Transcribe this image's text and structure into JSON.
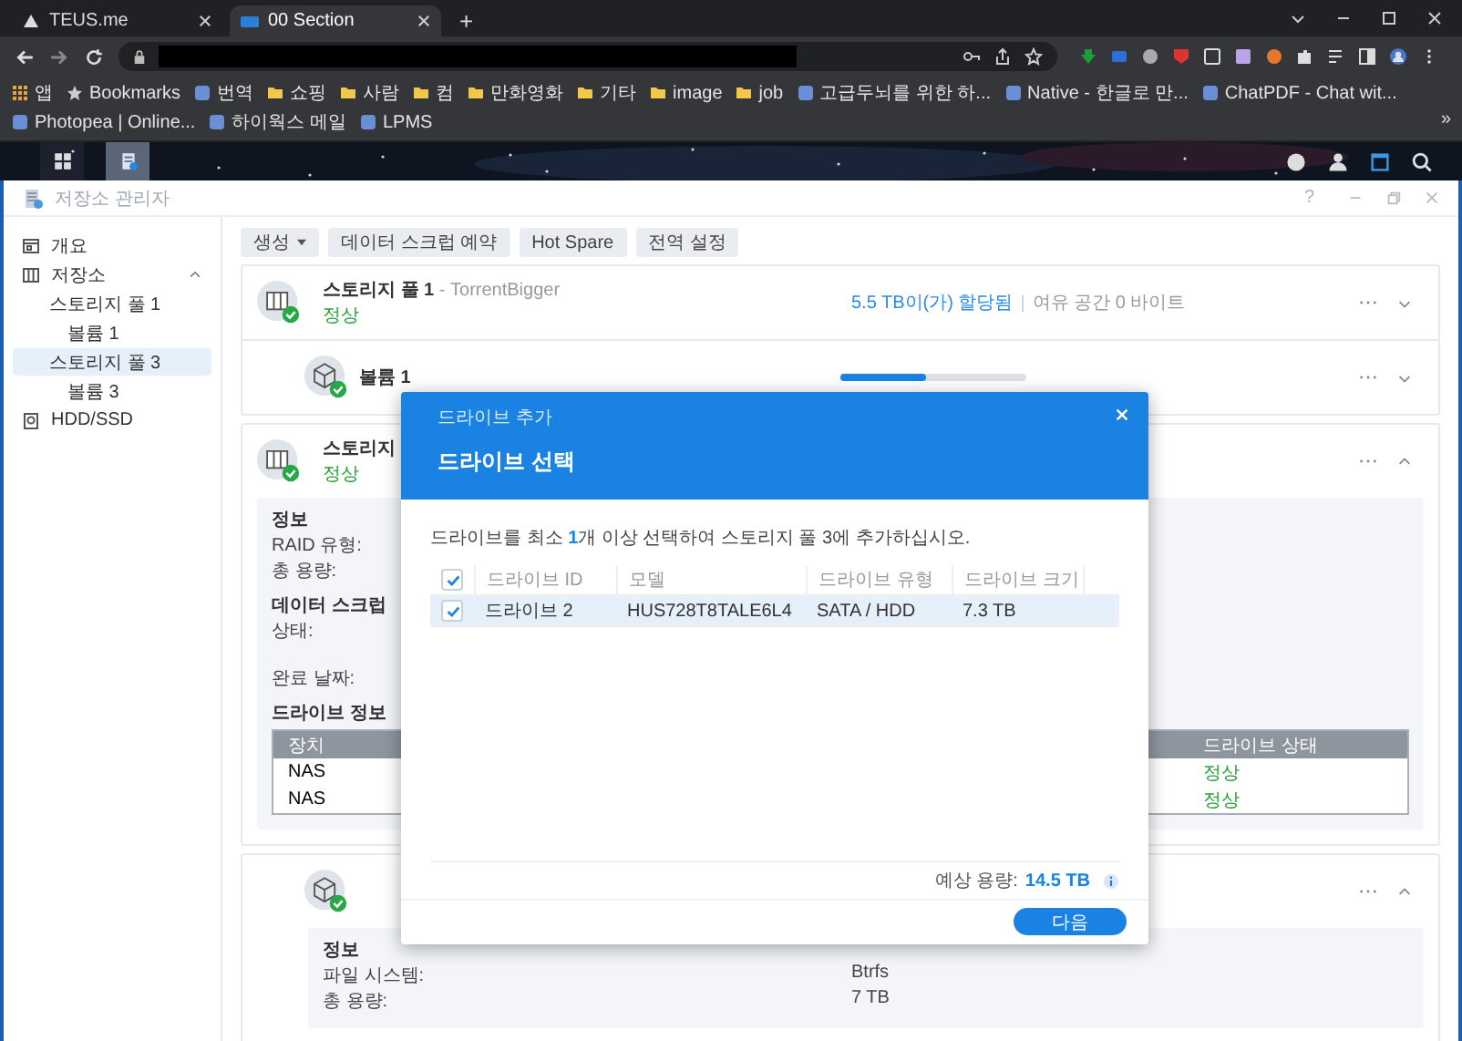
{
  "browser": {
    "tabs": [
      {
        "title": "TEUS.me",
        "kind": "teus",
        "selected": false
      },
      {
        "title": "00 Section",
        "kind": "dsm",
        "selected": true
      }
    ],
    "new_tab": "+",
    "bookmarks": [
      {
        "label": "앱",
        "kind": "apps"
      },
      {
        "label": "Bookmarks",
        "kind": "star"
      },
      {
        "label": "번역",
        "kind": "site"
      },
      {
        "label": "쇼핑",
        "kind": "folder"
      },
      {
        "label": "사람",
        "kind": "folder"
      },
      {
        "label": "컴",
        "kind": "folder"
      },
      {
        "label": "만화영화",
        "kind": "folder"
      },
      {
        "label": "기타",
        "kind": "folder"
      },
      {
        "label": "image",
        "kind": "folder"
      },
      {
        "label": "job",
        "kind": "folder"
      },
      {
        "label": "고급두뇌를 위한 하...",
        "kind": "site"
      },
      {
        "label": "Native - 한글로 만...",
        "kind": "site"
      },
      {
        "label": "ChatPDF - Chat wit...",
        "kind": "site"
      },
      {
        "label": "Photopea | Online...",
        "kind": "site"
      },
      {
        "label": "하이웍스 메일",
        "kind": "site"
      },
      {
        "label": "LPMS",
        "kind": "site"
      }
    ],
    "more": "»"
  },
  "app": {
    "title": "저장소 관리자",
    "help": "?",
    "sidebar": [
      {
        "label": "개요",
        "kind": "overview",
        "selected": false
      },
      {
        "label": "저장소",
        "kind": "storage",
        "selected": false,
        "expanded": true,
        "children": [
          {
            "label": "스토리지 풀 1",
            "selected": false,
            "children": [
              {
                "label": "볼륨 1",
                "selected": false
              }
            ]
          },
          {
            "label": "스토리지 풀 3",
            "selected": true,
            "children": [
              {
                "label": "볼륨 3",
                "selected": false
              }
            ]
          }
        ]
      },
      {
        "label": "HDD/SSD",
        "kind": "hdd",
        "selected": false
      }
    ],
    "toolbar": [
      {
        "label": "생성",
        "dropdown": true
      },
      {
        "label": "데이터 스크럽 예약",
        "dropdown": false
      },
      {
        "label": "Hot Spare",
        "dropdown": false
      },
      {
        "label": "전역 설정",
        "dropdown": false
      }
    ],
    "pool_1": {
      "name": "스토리지 풀 1",
      "subtitle": "- TorrentBigger",
      "separator": "|",
      "status": "정상",
      "allocated": "5.5 TB이(가) 할당됨",
      "free": "여유 공간 0 바이트",
      "expanded": false,
      "volume": {
        "name": "볼륨 1",
        "level": 0.46,
        "expanded": false
      }
    },
    "pool_3": {
      "name": "스토리지",
      "status": "정상",
      "expanded": true,
      "info_title": "정보",
      "info_labels": [
        "RAID 유형:",
        "총 용량:"
      ],
      "scrub_title": "데이터 스크럽",
      "scrub_labels": [
        "상태:",
        "완료 날짜:"
      ],
      "drives_title": "드라이브 정보",
      "drive_columns": [
        "장치",
        "드라이브 상태"
      ],
      "drives": [
        {
          "device": "NAS",
          "status": "정상"
        },
        {
          "device": "NAS",
          "status": "정상"
        }
      ]
    },
    "volume_3": {
      "expanded": true,
      "info_title": "정보",
      "info": [
        {
          "label": "파일 시스템:",
          "value": "Btrfs"
        },
        {
          "label": "총 용량:",
          "value": "7 TB"
        }
      ]
    }
  },
  "dialog": {
    "caption": "드라이브 추가",
    "title": "드라이브 선택",
    "instruction": "드라이브를 최소 **1**개 이상 선택하여 스토리지 풀 3에 추가하십시오.",
    "all_checked": true,
    "columns": [
      "드라이브 ID",
      "모델",
      "드라이브 유형",
      "드라이브 크기"
    ],
    "rows": [
      {
        "cells": [
          "드라이브 2",
          "HUS728T8TALE6L4",
          "SATA / HDD",
          "7.3 TB"
        ],
        "checked": true,
        "selected": true
      }
    ],
    "estimate_label": "예상 용량:",
    "estimate_value": "14.5 TB",
    "next_button": "다음"
  }
}
